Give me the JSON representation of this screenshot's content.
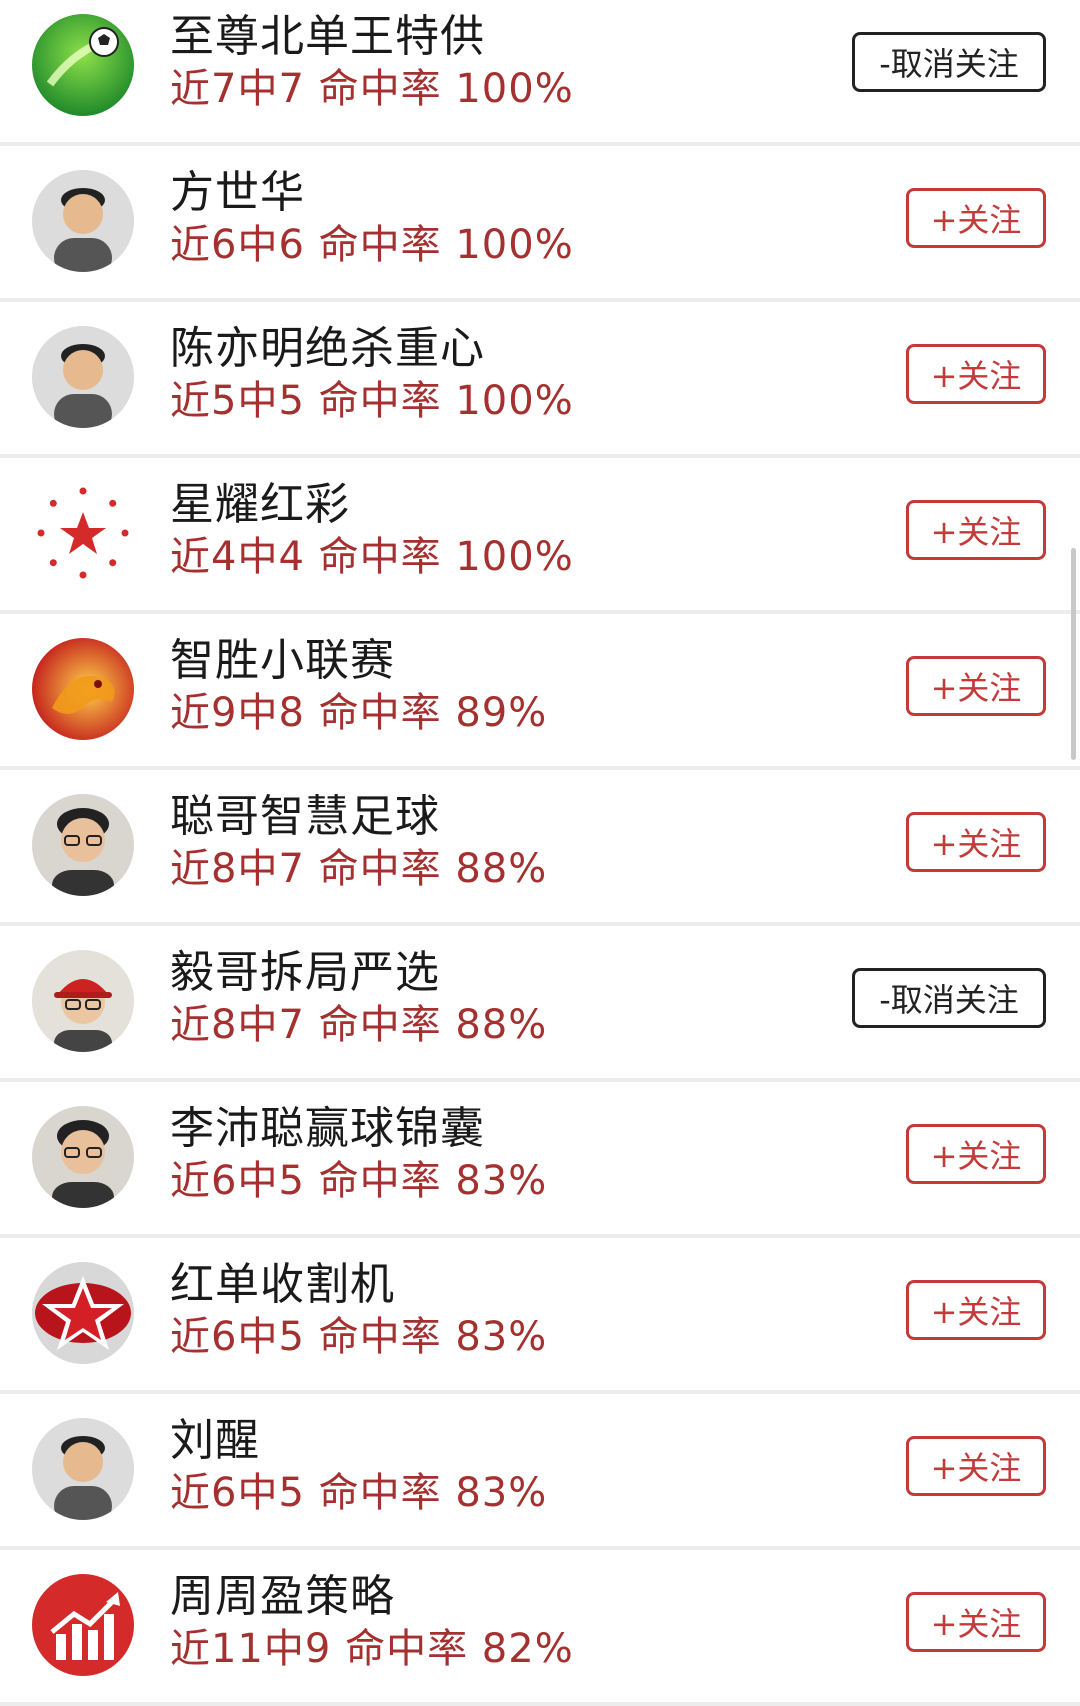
{
  "labels": {
    "follow": "+关注",
    "unfollow": "-取消关注"
  },
  "experts": [
    {
      "name": "至尊北单王特供",
      "record": "近7中7",
      "rate_label": "命中率",
      "rate": "100%",
      "following": true,
      "avatar": "football-logo"
    },
    {
      "name": "方世华",
      "record": "近6中6",
      "rate_label": "命中率",
      "rate": "100%",
      "following": false,
      "avatar": "man-photo"
    },
    {
      "name": "陈亦明绝杀重心",
      "record": "近5中5",
      "rate_label": "命中率",
      "rate": "100%",
      "following": false,
      "avatar": "man-photo"
    },
    {
      "name": "星耀红彩",
      "record": "近4中4",
      "rate_label": "命中率",
      "rate": "100%",
      "following": false,
      "avatar": "red-star-logo"
    },
    {
      "name": "智胜小联赛",
      "record": "近9中8",
      "rate_label": "命中率",
      "rate": "89%",
      "following": false,
      "avatar": "dragon-logo"
    },
    {
      "name": "聪哥智慧足球",
      "record": "近8中7",
      "rate_label": "命中率",
      "rate": "88%",
      "following": false,
      "avatar": "man-glasses-photo"
    },
    {
      "name": "毅哥拆局严选",
      "record": "近8中7",
      "rate_label": "命中率",
      "rate": "88%",
      "following": true,
      "avatar": "man-red-cap-photo"
    },
    {
      "name": "李沛聪赢球锦囊",
      "record": "近6中5",
      "rate_label": "命中率",
      "rate": "83%",
      "following": false,
      "avatar": "man-glasses-photo"
    },
    {
      "name": "红单收割机",
      "record": "近6中5",
      "rate_label": "命中率",
      "rate": "83%",
      "following": false,
      "avatar": "red-star-badge-logo"
    },
    {
      "name": "刘醒",
      "record": "近6中5",
      "rate_label": "命中率",
      "rate": "83%",
      "following": false,
      "avatar": "man-photo"
    },
    {
      "name": "周周盈策略",
      "record": "近11中9",
      "rate_label": "命中率",
      "rate": "82%",
      "following": false,
      "avatar": "red-chart-logo"
    }
  ],
  "colors": {
    "accent": "#c43a3a",
    "stats_text": "#a43030",
    "name_text": "#1a1a1a",
    "unfollow_border": "#222222"
  }
}
